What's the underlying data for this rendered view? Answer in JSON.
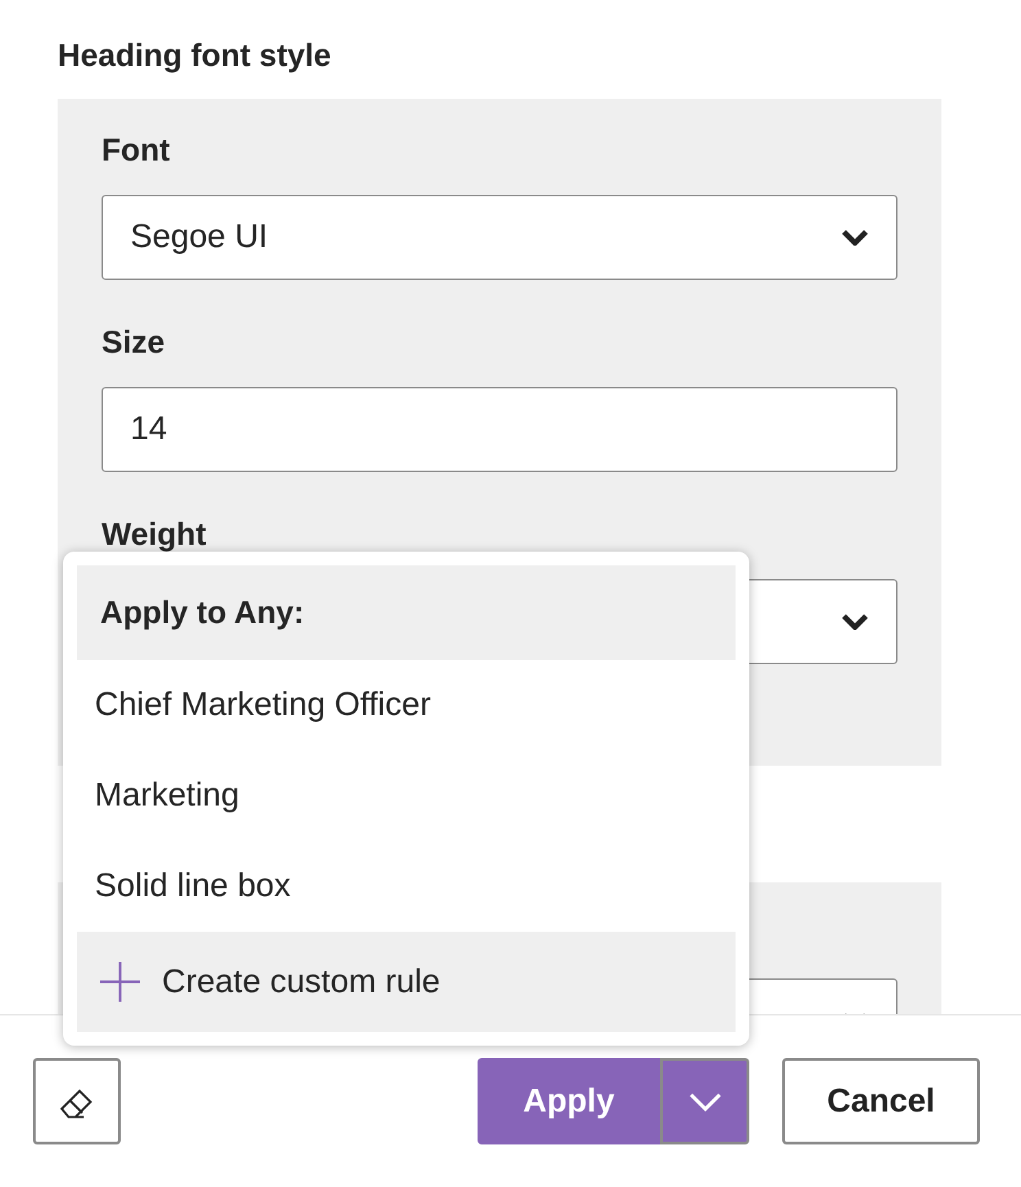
{
  "sections": [
    {
      "heading": "Heading font style",
      "fields": [
        {
          "kind": "select",
          "label": "Font",
          "value": "Segoe UI"
        },
        {
          "kind": "input",
          "label": "Size",
          "value": "14"
        },
        {
          "kind": "select",
          "label": "Weight"
        }
      ]
    },
    {
      "fields": [
        {
          "kind": "select"
        }
      ]
    }
  ],
  "menu": {
    "header": "Apply to Any:",
    "items": [
      {
        "kind": "option",
        "label": "Chief Marketing Officer"
      },
      {
        "kind": "option",
        "label": "Marketing"
      },
      {
        "kind": "option",
        "label": "Solid line box"
      },
      {
        "kind": "action",
        "label": "Create custom rule"
      }
    ]
  },
  "footer": {
    "apply": "Apply",
    "cancel": "Cancel"
  }
}
